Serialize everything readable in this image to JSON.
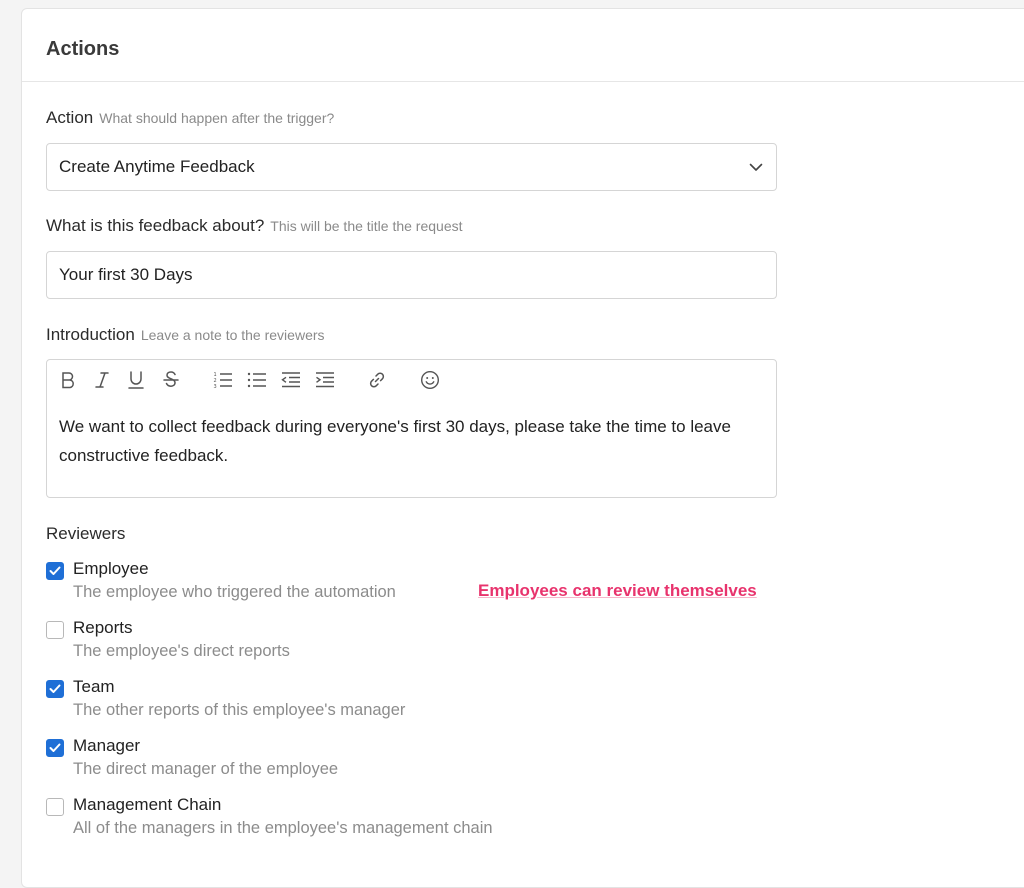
{
  "section": {
    "title": "Actions"
  },
  "action": {
    "label": "Action",
    "hint": "What should happen after the trigger?",
    "selected": "Create Anytime Feedback"
  },
  "about": {
    "label": "What is this feedback about?",
    "hint": "This will be the title the request",
    "value": "Your first 30 Days"
  },
  "introduction": {
    "label": "Introduction",
    "hint": "Leave a note to the reviewers",
    "toolbar": [
      "bold-icon",
      "italic-icon",
      "underline-icon",
      "strikethrough-icon",
      "ordered-list-icon",
      "bullet-list-icon",
      "outdent-icon",
      "indent-icon",
      "link-icon",
      "emoji-icon"
    ],
    "body": "We want to collect feedback during everyone's first 30 days, please take the time to leave constructive feedback."
  },
  "reviewers": {
    "label": "Reviewers",
    "items": [
      {
        "name": "Employee",
        "description": "The employee who triggered the automation",
        "checked": true
      },
      {
        "name": "Reports",
        "description": "The employee's direct reports",
        "checked": false
      },
      {
        "name": "Team",
        "description": "The other reports of this employee's manager",
        "checked": true
      },
      {
        "name": "Manager",
        "description": "The direct manager of the employee",
        "checked": true
      },
      {
        "name": "Management Chain",
        "description": "All of the managers in the employee's management chain",
        "checked": false
      }
    ]
  },
  "annotation": {
    "text": "Employees can review themselves",
    "color": "#e8336d"
  },
  "colors": {
    "accent": "#1f6fd6",
    "border": "#d5d5d5",
    "hint": "#8a8a8a"
  }
}
